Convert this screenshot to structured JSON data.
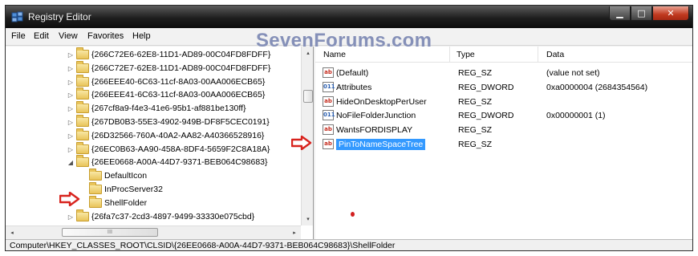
{
  "window": {
    "title": "Registry Editor",
    "minimize_glyph": "▁",
    "maximize_glyph": "□",
    "close_glyph": "✕"
  },
  "watermark": "SevenForums.com",
  "menu": {
    "file": "File",
    "edit": "Edit",
    "view": "View",
    "favorites": "Favorites",
    "help": "Help"
  },
  "tree": {
    "items": [
      {
        "label": "{266C72E6-62E8-11D1-AD89-00C04FD8FDFF}",
        "expander": "▷",
        "depth": 0
      },
      {
        "label": "{266C72E7-62E8-11D1-AD89-00C04FD8FDFF}",
        "expander": "▷",
        "depth": 0
      },
      {
        "label": "{266EEE40-6C63-11cf-8A03-00AA006ECB65}",
        "expander": "▷",
        "depth": 0
      },
      {
        "label": "{266EEE41-6C63-11cf-8A03-00AA006ECB65}",
        "expander": "▷",
        "depth": 0
      },
      {
        "label": "{267cf8a9-f4e3-41e6-95b1-af881be130ff}",
        "expander": "▷",
        "depth": 0
      },
      {
        "label": "{267DB0B3-55E3-4902-949B-DF8F5CEC0191}",
        "expander": "▷",
        "depth": 0
      },
      {
        "label": "{26D32566-760A-40A2-AA82-A40366528916}",
        "expander": "▷",
        "depth": 0
      },
      {
        "label": "{26EC0B63-AA90-458A-8DF4-5659F2C8A18A}",
        "expander": "▷",
        "depth": 0
      },
      {
        "label": "{26EE0668-A00A-44D7-9371-BEB064C98683}",
        "expander": "◢",
        "depth": 0
      },
      {
        "label": "DefaultIcon",
        "expander": "",
        "depth": 1
      },
      {
        "label": "InProcServer32",
        "expander": "",
        "depth": 1
      },
      {
        "label": "ShellFolder",
        "expander": "",
        "depth": 1
      },
      {
        "label": "{26fa7c37-2cd3-4897-9499-33330e075cbd}",
        "expander": "▷",
        "depth": 0
      }
    ],
    "hscroll_left_glyph": "◂",
    "hscroll_right_glyph": "▸",
    "hscroll_grip": "III",
    "vscroll_up_glyph": "▴",
    "vscroll_down_glyph": "▾"
  },
  "list": {
    "columns": {
      "name": "Name",
      "type": "Type",
      "data": "Data"
    },
    "rows": [
      {
        "icon": "ab",
        "kind": "sz",
        "name": "(Default)",
        "type": "REG_SZ",
        "data": "(value not set)"
      },
      {
        "icon": "011",
        "kind": "dw",
        "name": "Attributes",
        "type": "REG_DWORD",
        "data": "0xa0000004 (2684354564)"
      },
      {
        "icon": "ab",
        "kind": "sz",
        "name": "HideOnDesktopPerUser",
        "type": "REG_SZ",
        "data": ""
      },
      {
        "icon": "011",
        "kind": "dw",
        "name": "NoFileFolderJunction",
        "type": "REG_DWORD",
        "data": "0x00000001 (1)"
      },
      {
        "icon": "ab",
        "kind": "sz",
        "name": "WantsFORDISPLAY",
        "type": "REG_SZ",
        "data": ""
      },
      {
        "icon": "ab",
        "kind": "sz",
        "name": "PinToNameSpaceTree",
        "type": "REG_SZ",
        "data": ""
      }
    ]
  },
  "status": {
    "path": "Computer\\HKEY_CLASSES_ROOT\\CLSID\\{26EE0668-A00A-44D7-9371-BEB064C98683}\\ShellFolder"
  },
  "colors": {
    "annotation_arrow": "#d8231d",
    "selection": "#3399ff",
    "watermark": "#8590b8"
  }
}
